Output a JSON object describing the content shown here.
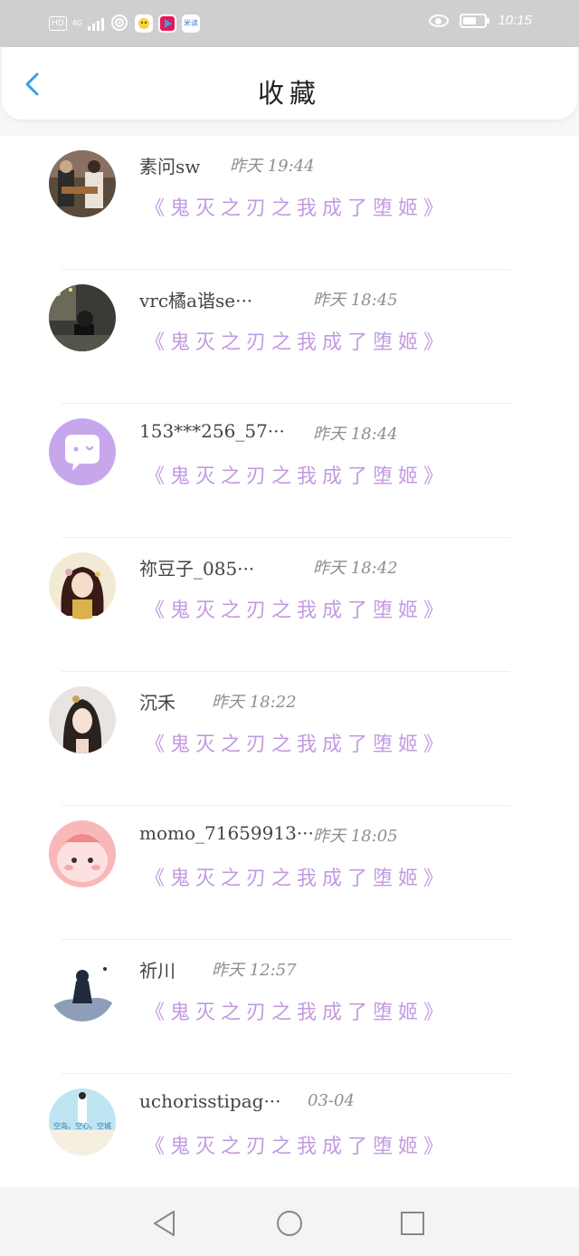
{
  "status_bar": {
    "tag_hd": "HD",
    "tag_4g": "4G",
    "app_icon_2_text": "KK",
    "app_icon_3_text": "米读",
    "time": "10:15"
  },
  "header": {
    "title": "收藏"
  },
  "items": [
    {
      "name": "素问sw",
      "time": "昨天 19:44",
      "book": "《鬼灭之刃之我成了堕姬》"
    },
    {
      "name": "vrc橘a谐se···",
      "time": "昨天 18:45",
      "book": "《鬼灭之刃之我成了堕姬》"
    },
    {
      "name": "153***256_57···",
      "time": "昨天 18:44",
      "book": "《鬼灭之刃之我成了堕姬》"
    },
    {
      "name": "祢豆子_085···",
      "time": "昨天 18:42",
      "book": "《鬼灭之刃之我成了堕姬》"
    },
    {
      "name": "沉禾",
      "time": "昨天 18:22",
      "book": "《鬼灭之刃之我成了堕姬》"
    },
    {
      "name": "momo_71659913···",
      "time": "昨天 18:05",
      "book": "《鬼灭之刃之我成了堕姬》"
    },
    {
      "name": "祈川",
      "time": "昨天 12:57",
      "book": "《鬼灭之刃之我成了堕姬》"
    },
    {
      "name": "uchorisstipag···",
      "time": "03-04",
      "book": "《鬼灭之刃之我成了堕姬》"
    }
  ],
  "avatars": {
    "item8_caption": "空岛。空心。空城"
  },
  "colors": {
    "book_title": "#c29be0",
    "back_arrow": "#3a9ee6",
    "status_bar": "#cfcfd1"
  }
}
